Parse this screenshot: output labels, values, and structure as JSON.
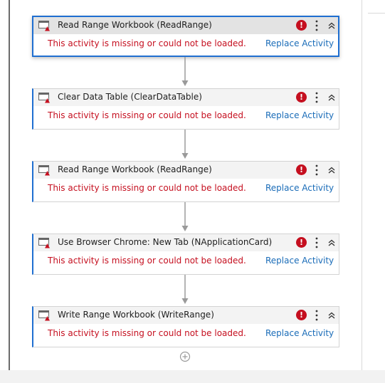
{
  "activities": [
    {
      "title": "Read Range Workbook (ReadRange)",
      "error": "This activity is missing or could not be loaded.",
      "action": "Replace Activity",
      "selected": true
    },
    {
      "title": "Clear Data Table (ClearDataTable)",
      "error": "This activity is missing or could not be loaded.",
      "action": "Replace Activity",
      "selected": false
    },
    {
      "title": "Read Range Workbook (ReadRange)",
      "error": "This activity is missing or could not be loaded.",
      "action": "Replace Activity",
      "selected": false
    },
    {
      "title": "Use Browser Chrome: New Tab (NApplicationCard)",
      "error": "This activity is missing or could not be loaded.",
      "action": "Replace Activity",
      "selected": false
    },
    {
      "title": "Write Range Workbook (WriteRange)",
      "error": "This activity is missing or could not be loaded.",
      "action": "Replace Activity",
      "selected": false
    }
  ],
  "icons": {
    "activity": "missing-activity-icon",
    "error": "error-icon",
    "more": "more-options-icon",
    "collapse": "collapse-icon",
    "add": "add-activity-icon"
  },
  "colors": {
    "accent": "#1f6fd1",
    "error": "#c50f1f",
    "link": "#1a6cb8"
  }
}
